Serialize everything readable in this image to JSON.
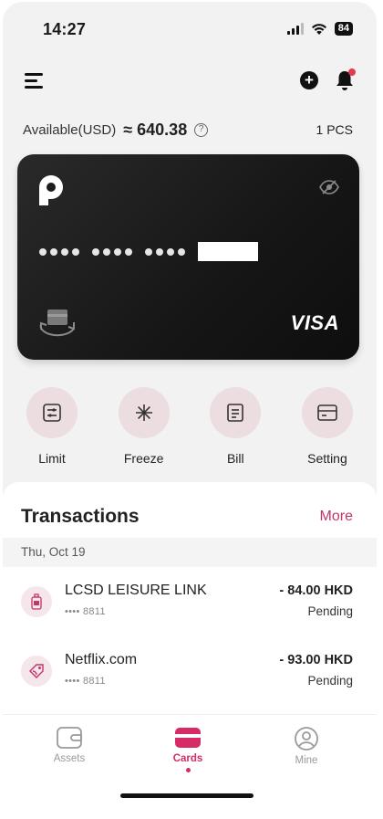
{
  "status_bar": {
    "time": "14:27",
    "battery": "84"
  },
  "header": {
    "menu_icon": "hamburger-icon",
    "add_icon": "plus-circle-icon",
    "notification_icon": "bell-icon"
  },
  "balance": {
    "label": "Available(USD)",
    "amount": "≈ 640.38",
    "cards_count": "1 PCS"
  },
  "card": {
    "brand": "VISA",
    "eye_icon": "eye-off-icon",
    "swap_icon": "card-swap-icon"
  },
  "actions": [
    {
      "label": "Limit",
      "icon": "sliders-icon"
    },
    {
      "label": "Freeze",
      "icon": "snowflake-icon"
    },
    {
      "label": "Bill",
      "icon": "document-icon"
    },
    {
      "label": "Setting",
      "icon": "card-icon"
    }
  ],
  "transactions": {
    "title": "Transactions",
    "more_label": "More",
    "date": "Thu, Oct 19",
    "items": [
      {
        "merchant": "LCSD LEISURE LINK",
        "card": "•••• 8811",
        "amount": "- 84.00 HKD",
        "status": "Pending",
        "icon": "bottle-icon"
      },
      {
        "merchant": "Netflix.com",
        "card": "•••• 8811",
        "amount": "- 93.00 HKD",
        "status": "Pending",
        "icon": "tag-icon"
      }
    ]
  },
  "nav": [
    {
      "label": "Assets",
      "icon": "wallet-icon"
    },
    {
      "label": "Cards",
      "icon": "card-icon",
      "active": true
    },
    {
      "label": "Mine",
      "icon": "user-icon"
    }
  ],
  "colors": {
    "accent": "#d62b68",
    "card_bg": "#1a1a1a",
    "action_bg": "#ecdde0"
  }
}
